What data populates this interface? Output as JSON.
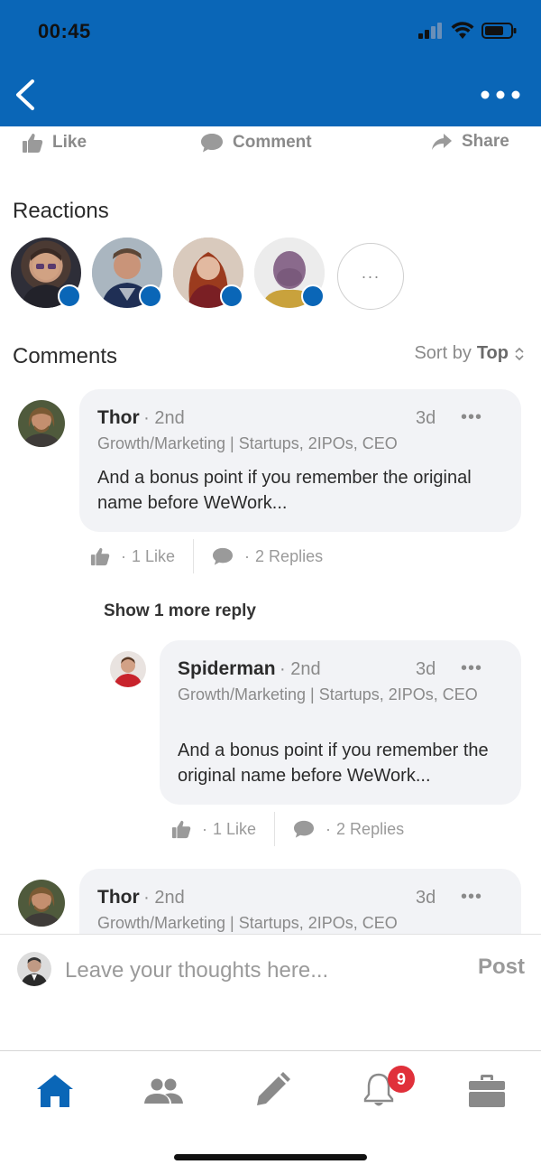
{
  "status_bar": {
    "time": "00:45"
  },
  "actions": {
    "like": "Like",
    "comment": "Comment",
    "share": "Share"
  },
  "reactions": {
    "title": "Reactions",
    "more": "···"
  },
  "comments": {
    "title": "Comments",
    "sort_prefix": "Sort by",
    "sort_value": "Top",
    "items": [
      {
        "name": "Thor",
        "degree": "· 2nd",
        "age": "3d",
        "headline": "Growth/Marketing | Startups, 2IPOs, CEO",
        "text": "And a bonus point if you remember the original name before WeWork...",
        "likes": "1 Like",
        "replies": "2 Replies"
      },
      {
        "name": "Spiderman",
        "degree": "· 2nd",
        "age": "3d",
        "headline": "Growth/Marketing | Startups, 2IPOs, CEO",
        "text": "And a bonus point if you remember the original name before WeWork...",
        "likes": "1 Like",
        "replies": "2 Replies"
      },
      {
        "name": "Thor",
        "degree": "· 2nd",
        "age": "3d",
        "headline": "Growth/Marketing | Startups, 2IPOs, CEO"
      }
    ],
    "show_more": "Show 1 more reply"
  },
  "composer": {
    "placeholder": "Leave your thoughts here...",
    "post": "Post"
  },
  "tabbar": {
    "notification_count": "9"
  },
  "colors": {
    "brand": "#0a66b7",
    "badge": "#e0303a",
    "bubble": "#f2f3f6"
  }
}
